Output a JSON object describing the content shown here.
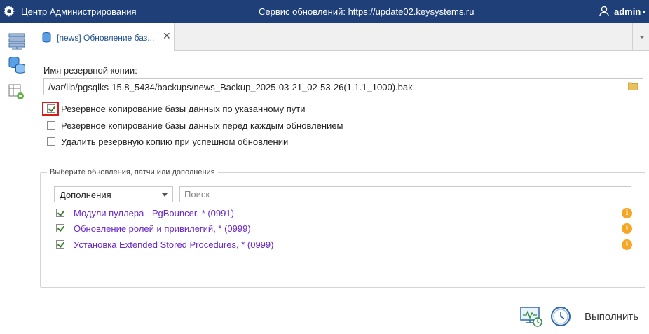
{
  "header": {
    "app_title": "Центр Администрирования",
    "service_text": "Сервис обновлений: https://update02.keysystems.ru",
    "username": "admin",
    "background": "#1e3f77"
  },
  "sidebar": {
    "items": [
      {
        "icon": "server-list-icon"
      },
      {
        "icon": "databases-icon"
      },
      {
        "icon": "table-settings-icon"
      }
    ]
  },
  "tabs": [
    {
      "label": "[news] Обновление баз...",
      "active": true
    }
  ],
  "backup": {
    "label": "Имя резервной копии:",
    "path": "/var/lib/pgsqlks-15.8_5434/backups/news_Backup_2025-03-21_02-53-26(1.1.1_1000).bak"
  },
  "options": [
    {
      "label": "Резервное копирование базы данных по указанному пути",
      "checked": true
    },
    {
      "label": "Резервное копирование базы данных перед каждым обновлением",
      "checked": false
    },
    {
      "label": "Удалить резервную копию при успешном обновлении",
      "checked": false
    }
  ],
  "updates_group": {
    "legend": "Выберите обновления, патчи или дополнения",
    "filter_selected": "Дополнения",
    "search_placeholder": "Поиск",
    "items": [
      {
        "label": "Модули пуллера - PgBouncer, * (0991)",
        "checked": true
      },
      {
        "label": "Обновление ролей и привилегий, * (0999)",
        "checked": true
      },
      {
        "label": "Установка Extended Stored Procedures, * (0999)",
        "checked": true
      }
    ]
  },
  "footer": {
    "run_label": "Выполнить"
  }
}
